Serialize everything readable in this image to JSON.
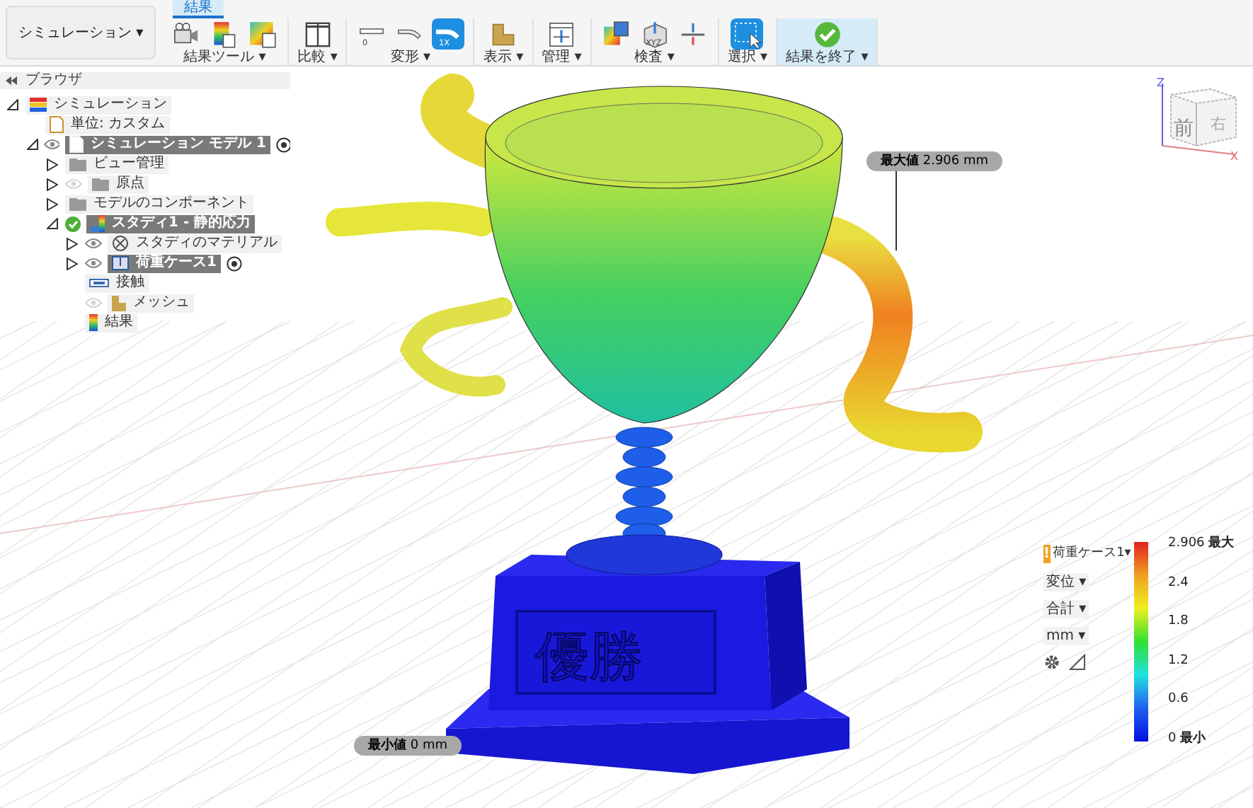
{
  "toolbar": {
    "workspace": "シミュレーション ▾",
    "tabs": [
      {
        "label": "結果",
        "selected": true
      }
    ],
    "groups": [
      {
        "label": "結果ツール ▾",
        "highlighted": false,
        "icons": [
          {
            "kind": "camera",
            "selected": false
          },
          {
            "kind": "plot",
            "selected": false
          },
          {
            "kind": "compare",
            "selected": false
          }
        ]
      },
      {
        "label": "比較 ▾",
        "highlighted": false,
        "icons": [
          {
            "kind": "split",
            "selected": false
          }
        ]
      },
      {
        "label": "変形 ▾",
        "highlighted": false,
        "icons": [
          {
            "kind": "bar",
            "text": "0",
            "selected": false
          },
          {
            "kind": "bent",
            "selected": false
          },
          {
            "kind": "bent",
            "text": "1X",
            "selected": true
          }
        ]
      },
      {
        "label": "表示 ▾",
        "highlighted": false,
        "icons": [
          {
            "kind": "mesh",
            "selected": false
          }
        ]
      },
      {
        "label": "管理 ▾",
        "highlighted": false,
        "icons": [
          {
            "kind": "manage",
            "selected": false
          }
        ]
      },
      {
        "label": "検査 ▾",
        "highlighted": false,
        "icons": [
          {
            "kind": "probe",
            "selected": false
          },
          {
            "kind": "box",
            "text": "XYZ",
            "selected": false
          },
          {
            "kind": "section",
            "selected": false
          }
        ]
      },
      {
        "label": "選択 ▾",
        "highlighted": false,
        "icons": [
          {
            "kind": "select",
            "selected": true
          }
        ]
      },
      {
        "label": "結果を終了 ▾",
        "highlighted": true,
        "icons": [
          {
            "kind": "finish",
            "selected": false
          }
        ]
      }
    ]
  },
  "browser": {
    "title": "ブラウザ",
    "tree": [
      {
        "label": "シミュレーション",
        "kind": "sim",
        "expanded": true,
        "children": [
          {
            "label": "単位: カスタム",
            "kind": "doc"
          },
          {
            "label": "シミュレーション モデル 1",
            "kind": "model",
            "expanded": true,
            "visible": true,
            "highlighted": true,
            "target": true,
            "children": [
              {
                "label": "ビュー管理",
                "kind": "folder",
                "expanded": false
              },
              {
                "label": "原点",
                "kind": "folder",
                "expanded": false,
                "visible": false
              },
              {
                "label": "モデルのコンポーネント",
                "kind": "folder",
                "expanded": false
              },
              {
                "label": "スタディ1 - 静的応力",
                "kind": "study",
                "expanded": true,
                "highlighted": true,
                "checked": true,
                "children": [
                  {
                    "label": "スタディのマテリアル",
                    "kind": "material",
                    "expanded": false,
                    "visible": true
                  },
                  {
                    "label": "荷重ケース1",
                    "kind": "load",
                    "expanded": false,
                    "visible": true,
                    "highlighted": true,
                    "target": true
                  },
                  {
                    "label": "接触",
                    "kind": "contact"
                  },
                  {
                    "label": "メッシュ",
                    "kind": "meshitem",
                    "visible": false
                  },
                  {
                    "label": "結果",
                    "kind": "result"
                  }
                ]
              }
            ]
          }
        ]
      }
    ]
  },
  "viewport": {
    "engraving": "優勝",
    "viewcube": {
      "front": "前",
      "right": "右",
      "z_axis": "Z",
      "x_axis": "X"
    },
    "probes": [
      {
        "kind": "max",
        "text": "**最大値** 2.906 mm"
      },
      {
        "kind": "min",
        "text": "**最小値** 0 mm"
      }
    ]
  },
  "legend": {
    "load_case": "荷重ケース1▾",
    "warning": "!",
    "dropdowns": [
      "変位 ▾",
      "合計 ▾",
      "mm ▾"
    ],
    "scale_labels": [
      "2.906 **最大**",
      "2.4",
      "1.8",
      "1.2",
      "0.6",
      "0 **最小**"
    ]
  }
}
